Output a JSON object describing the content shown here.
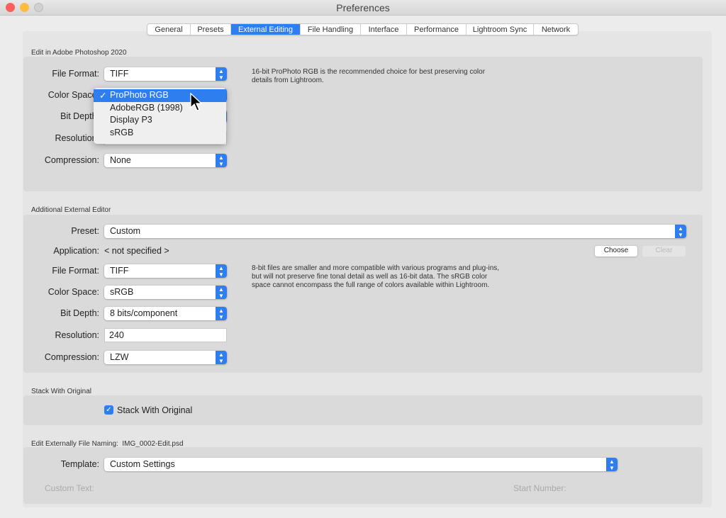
{
  "window": {
    "title": "Preferences"
  },
  "tabs": [
    "General",
    "Presets",
    "External Editing",
    "File Handling",
    "Interface",
    "Performance",
    "Lightroom Sync",
    "Network"
  ],
  "active_tab": "External Editing",
  "photoshop": {
    "heading": "Edit in Adobe Photoshop 2020",
    "file_format_label": "File Format:",
    "file_format": "TIFF",
    "color_space_label": "Color Space:",
    "color_space": "ProPhoto RGB",
    "bit_depth_label": "Bit Depth:",
    "resolution_label": "Resolution:",
    "compression_label": "Compression:",
    "compression": "None",
    "note": "16-bit ProPhoto RGB is the recommended choice for best preserving color details from Lightroom.",
    "color_space_menu": [
      "ProPhoto RGB",
      "AdobeRGB (1998)",
      "Display P3",
      "sRGB"
    ],
    "checkmark": "✓"
  },
  "additional": {
    "heading": "Additional External Editor",
    "preset_label": "Preset:",
    "preset": "Custom",
    "application_label": "Application:",
    "application": "< not specified >",
    "choose": "Choose",
    "clear": "Clear",
    "file_format_label": "File Format:",
    "file_format": "TIFF",
    "color_space_label": "Color Space:",
    "color_space": "sRGB",
    "bit_depth_label": "Bit Depth:",
    "bit_depth": "8 bits/component",
    "resolution_label": "Resolution:",
    "resolution": "240",
    "compression_label": "Compression:",
    "compression": "LZW",
    "note": "8-bit files are smaller and more compatible with various programs and plug-ins, but will not preserve fine tonal detail as well as 16-bit data. The sRGB color space cannot encompass the full range of colors available within Lightroom."
  },
  "stack": {
    "heading": "Stack With Original",
    "checkbox_label": "Stack With Original",
    "checked": true
  },
  "naming": {
    "heading": "Edit Externally File Naming:",
    "example": "IMG_0002-Edit.psd",
    "template_label": "Template:",
    "template": "Custom Settings",
    "custom_text_label": "Custom Text:",
    "start_number_label": "Start Number:"
  },
  "colors": {
    "accent": "#2f7ef0",
    "close": "#fc605b",
    "minimize": "#fdbc40"
  }
}
